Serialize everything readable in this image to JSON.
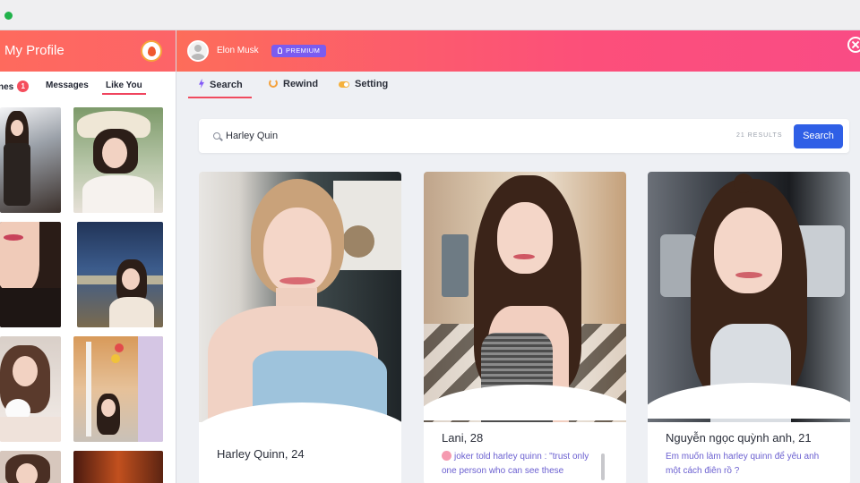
{
  "left_panel": {
    "title": "My Profile",
    "tabs": [
      {
        "label": "nes",
        "badge": "1"
      },
      {
        "label": "Messages"
      },
      {
        "label": "Like You"
      }
    ]
  },
  "header": {
    "user_name": "Elon Musk",
    "premium_label": "PREMIUM"
  },
  "nav_tabs": [
    {
      "label": "Search"
    },
    {
      "label": "Rewind"
    },
    {
      "label": "Setting"
    }
  ],
  "search": {
    "value": "Harley Quin",
    "results_label": "21 RESULTS",
    "button_label": "Search"
  },
  "profiles": [
    {
      "name": "Harley Quinn, 24",
      "bio": ""
    },
    {
      "name": "Lani, 28",
      "bio": "joker told harley quinn : \"trust only one person who can see these"
    },
    {
      "name": "Nguyễn ngọc quỳnh anh, 21",
      "bio": "Em muốn làm harley quinn để yêu anh một cách điên rồ ?"
    }
  ],
  "colors": {
    "header_gradient_start": "#fd6d5a",
    "header_gradient_end": "#f94c85",
    "premium_badge": "#7a5cf0",
    "search_button": "#2f5fe6",
    "active_tab_underline": "#f04a5e",
    "bio_text": "#6a5fd0"
  }
}
